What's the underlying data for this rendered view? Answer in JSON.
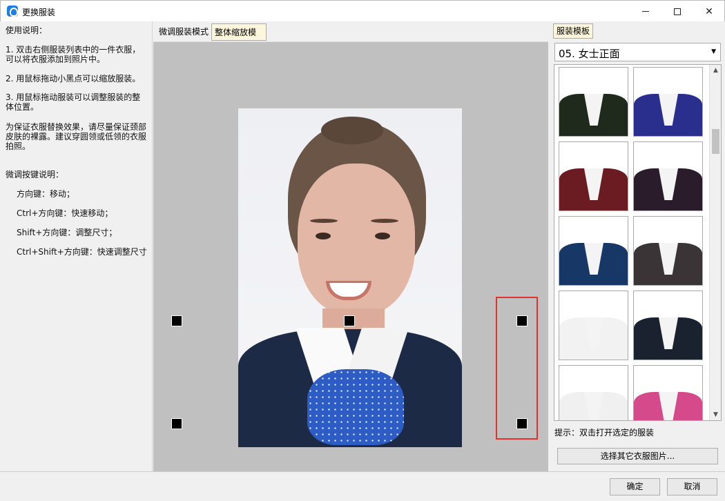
{
  "window": {
    "title": "更换服装"
  },
  "instructions": {
    "heading": "使用说明：",
    "step1": "1. 双击右侧服装列表中的一件衣服，\n可以将衣服添加到照片中。",
    "step2": "2. 用鼠标拖动小黑点可以缩放服装。",
    "step3": "3. 用鼠标拖动服装可以调整服装的整\n体位置。",
    "tip": "为保证衣服替换效果，请尽量保证颈部\n皮肤的裸露。建议穿圆领或低领的衣服\n拍照。",
    "keys_heading": "微调按键说明：",
    "key1": "方向键：移动；",
    "key2": "Ctrl+方向键：快速移动；",
    "key3": "Shift+方向键：调整尺寸；",
    "key4": "Ctrl+Shift+方向键：快速调整尺寸"
  },
  "mode_tabs": {
    "fine_tune": "微调服装模式",
    "scale_all": "整体缩放模式"
  },
  "templates": {
    "tab_label": "服装模板",
    "category": "05. 女士正面",
    "thumbs": [
      {
        "color": "#1f2a1c"
      },
      {
        "color": "#2a2f8e"
      },
      {
        "color": "#6a1c22"
      },
      {
        "color": "#2a1c2a"
      },
      {
        "color": "#173866"
      },
      {
        "color": "#3a3436"
      },
      {
        "color": "#f2f2f2"
      },
      {
        "color": "#1a2230"
      },
      {
        "color": "#f0f0f0"
      },
      {
        "color": "#d44a8a"
      }
    ]
  },
  "hint": "提示：双击打开选定的服装",
  "other_image_button": "选择其它衣服图片...",
  "footer": {
    "ok": "确定",
    "cancel": "取消"
  }
}
